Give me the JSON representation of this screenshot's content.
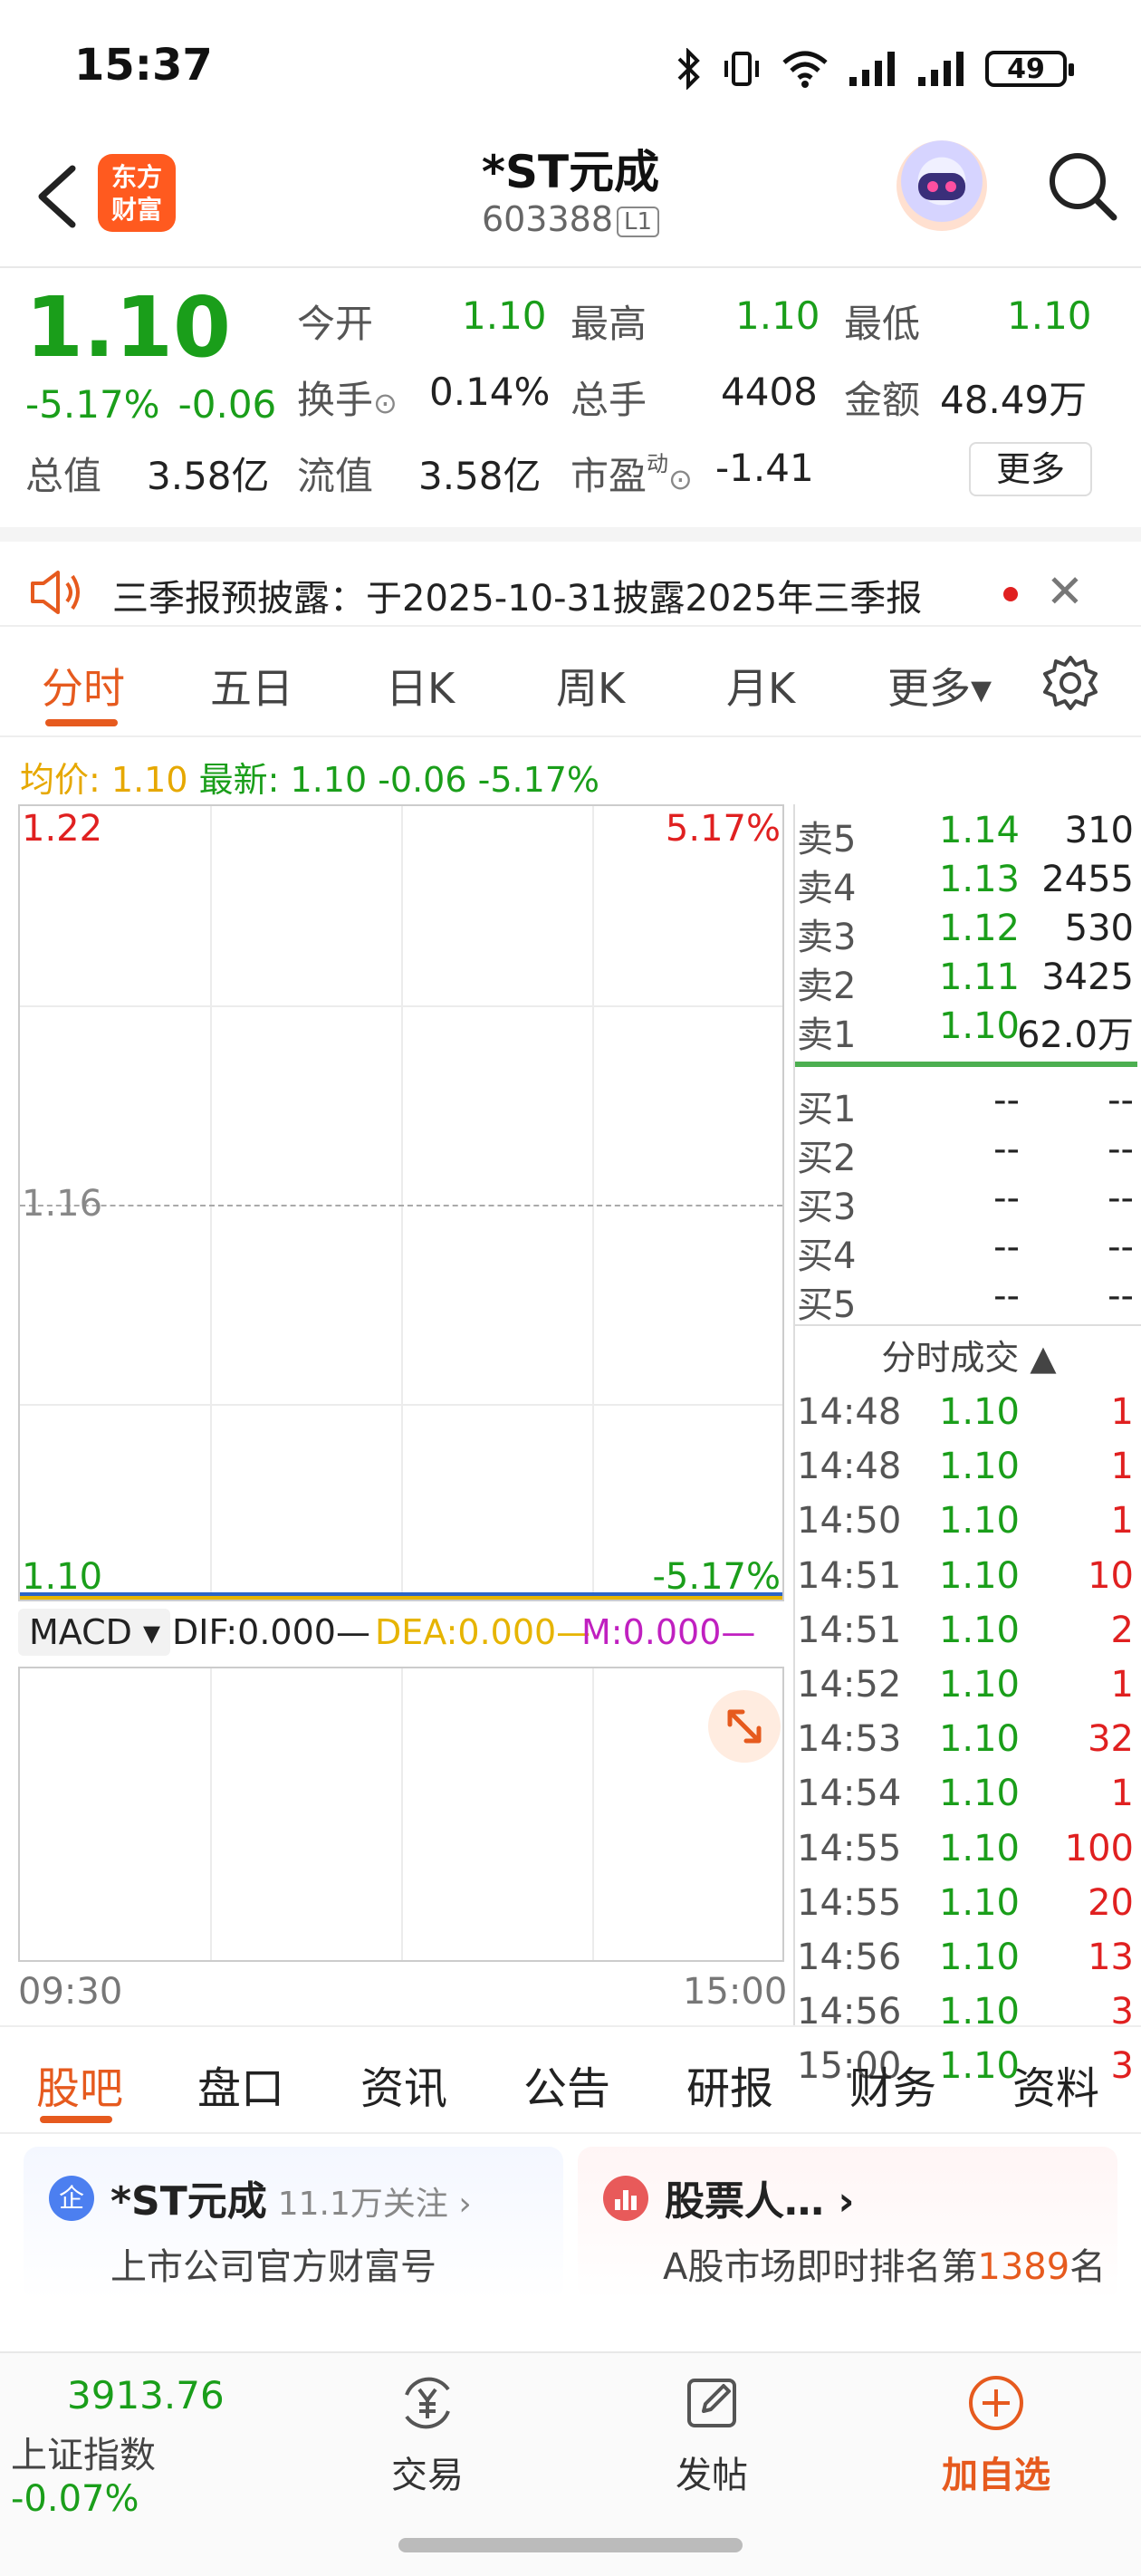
{
  "status_bar": {
    "time": "15:37",
    "battery": "49",
    "icons": [
      "bluetooth-icon",
      "vibrate-icon",
      "wifi-icon",
      "signal-icon",
      "signal-icon"
    ]
  },
  "header": {
    "logo_line1": "东方",
    "logo_line2": "财富",
    "stock_name": "*ST元成",
    "stock_code": "603388",
    "level_badge": "L1"
  },
  "quote": {
    "price": "1.10",
    "change_pct": "-5.17%",
    "change_abs": "-0.06",
    "open_label": "今开",
    "open": "1.10",
    "high_label": "最高",
    "high": "1.10",
    "low_label": "最低",
    "low": "1.10",
    "turnover_label": "换手",
    "turnover": "0.14%",
    "volume_label": "总手",
    "volume": "4408",
    "amount_label": "金额",
    "amount": "48.49万",
    "mktcap_label": "总值",
    "mktcap": "3.58亿",
    "float_label": "流值",
    "float_cap": "3.58亿",
    "pe_label": "市盈",
    "pe_sup": "动",
    "pe": "-1.41",
    "more_label": "更多"
  },
  "notice": {
    "text": "三季报预披露：于2025-10-31披露2025年三季报",
    "close": "✕"
  },
  "chart_tabs": [
    {
      "label": "分时",
      "active": true
    },
    {
      "label": "五日",
      "active": false
    },
    {
      "label": "日K",
      "active": false
    },
    {
      "label": "周K",
      "active": false
    },
    {
      "label": "月K",
      "active": false
    },
    {
      "label": "更多▾",
      "active": false
    }
  ],
  "avg_info": {
    "avg_label": "均价:",
    "avg_value": "1.10",
    "latest_label": "最新:",
    "latest_value": "1.10 -0.06 -5.17%"
  },
  "chart": {
    "price_top": "1.22",
    "pct_top": "5.17%",
    "price_mid": "1.16",
    "price_bottom": "1.10",
    "pct_bottom": "-5.17%",
    "time_start": "09:30",
    "time_end": "15:00"
  },
  "chart_data": {
    "type": "line",
    "x": [
      "09:30",
      "15:00"
    ],
    "series": [
      {
        "values": [
          1.1,
          1.1
        ],
        "color": "#2a64c8"
      },
      {
        "values": [
          1.1,
          1.1
        ],
        "color": "#e6b400"
      }
    ],
    "ylim": [
      1.1,
      1.22
    ],
    "y_ticks": [
      "1.22",
      "1.16",
      "1.10"
    ],
    "right_ticks": [
      "5.17%",
      "-5.17%"
    ]
  },
  "macd": {
    "selector": "MACD ▾",
    "dif": "DIF:0.000—",
    "dea": "DEA:0.000—",
    "m": "M:0.000—"
  },
  "order_book": {
    "asks": [
      {
        "label": "卖5",
        "price": "1.14",
        "volume": "310"
      },
      {
        "label": "卖4",
        "price": "1.13",
        "volume": "2455"
      },
      {
        "label": "卖3",
        "price": "1.12",
        "volume": "530"
      },
      {
        "label": "卖2",
        "price": "1.11",
        "volume": "3425"
      },
      {
        "label": "卖1",
        "price": "1.10",
        "volume": "62.0万"
      }
    ],
    "bids": [
      {
        "label": "买1",
        "price": "--",
        "volume": "--"
      },
      {
        "label": "买2",
        "price": "--",
        "volume": "--"
      },
      {
        "label": "买3",
        "price": "--",
        "volume": "--"
      },
      {
        "label": "买4",
        "price": "--",
        "volume": "--"
      },
      {
        "label": "买5",
        "price": "--",
        "volume": "--"
      }
    ],
    "trades_title": "分时成交 ▲",
    "trades": [
      {
        "time": "14:48",
        "price": "1.10",
        "volume": "1"
      },
      {
        "time": "14:48",
        "price": "1.10",
        "volume": "1"
      },
      {
        "time": "14:50",
        "price": "1.10",
        "volume": "1"
      },
      {
        "time": "14:51",
        "price": "1.10",
        "volume": "10"
      },
      {
        "time": "14:51",
        "price": "1.10",
        "volume": "2"
      },
      {
        "time": "14:52",
        "price": "1.10",
        "volume": "1"
      },
      {
        "time": "14:53",
        "price": "1.10",
        "volume": "32"
      },
      {
        "time": "14:54",
        "price": "1.10",
        "volume": "1"
      },
      {
        "time": "14:55",
        "price": "1.10",
        "volume": "100"
      },
      {
        "time": "14:55",
        "price": "1.10",
        "volume": "20"
      },
      {
        "time": "14:56",
        "price": "1.10",
        "volume": "13"
      },
      {
        "time": "14:56",
        "price": "1.10",
        "volume": "3"
      },
      {
        "time": "15:00",
        "price": "1.10",
        "volume": "3"
      }
    ]
  },
  "bottom_tabs": [
    {
      "label": "股吧",
      "active": true
    },
    {
      "label": "盘口",
      "active": false
    },
    {
      "label": "资讯",
      "active": false
    },
    {
      "label": "公告",
      "active": false
    },
    {
      "label": "研报",
      "active": false
    },
    {
      "label": "财务",
      "active": false
    },
    {
      "label": "资料",
      "active": false
    }
  ],
  "cards": {
    "company": {
      "icon": "企",
      "title": "*ST元成",
      "follow": "11.1万关注 ›",
      "subtitle": "上市公司官方财富号"
    },
    "rank": {
      "title": "股票人… ›",
      "sub_prefix": "A股市场即时排名第",
      "rank": "1389",
      "sub_suffix": "名"
    }
  },
  "bottom_nav": {
    "index_value": "3913.76",
    "index_label": "上证指数",
    "index_change": "-0.07%",
    "trade_label": "交易",
    "post_label": "发帖",
    "add_label": "加自选"
  },
  "colors": {
    "accent": "#e65a1e",
    "down": "#1a9e1a",
    "up": "#e02020"
  }
}
